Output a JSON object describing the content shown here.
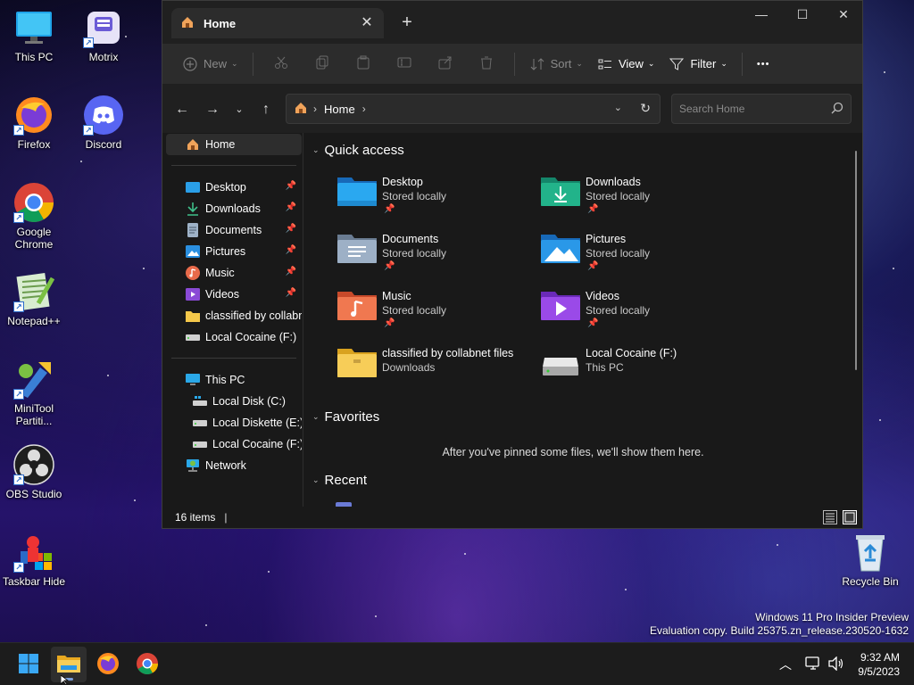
{
  "desktop": {
    "icons": [
      {
        "label": "This PC"
      },
      {
        "label": "Motrix"
      },
      {
        "label": "Firefox"
      },
      {
        "label": "Discord"
      },
      {
        "label": "Google Chrome"
      },
      {
        "label": "Notepad++"
      },
      {
        "label": "MiniTool Partiti..."
      },
      {
        "label": "OBS Studio"
      },
      {
        "label": "Taskbar Hide"
      },
      {
        "label": "Recycle Bin"
      }
    ],
    "watermark": {
      "line1": "Windows 11 Pro Insider Preview",
      "line2": "Evaluation copy. Build 25375.zn_release.230520-1632"
    }
  },
  "explorer": {
    "tab_title": "Home",
    "tab_close": "✕",
    "new_tab": "+",
    "window_controls": {
      "minimize": "—",
      "maximize": "☐",
      "close": "✕"
    },
    "toolbar": {
      "new_label": "New",
      "sort_label": "Sort",
      "view_label": "View",
      "filter_label": "Filter",
      "more_label": "•••"
    },
    "address": {
      "location": "Home",
      "search_placeholder": "Search Home"
    },
    "sidebar": {
      "home": "Home",
      "pinned": [
        {
          "label": "Desktop"
        },
        {
          "label": "Downloads"
        },
        {
          "label": "Documents"
        },
        {
          "label": "Pictures"
        },
        {
          "label": "Music"
        },
        {
          "label": "Videos"
        },
        {
          "label": "classified by collabnet files"
        },
        {
          "label": "Local Cocaine (F:)"
        }
      ],
      "this_pc": "This PC",
      "drives": [
        {
          "label": "Local Disk (C:)"
        },
        {
          "label": "Local Diskette (E:)"
        },
        {
          "label": "Local Cocaine (F:)"
        }
      ],
      "network": "Network"
    },
    "quick_access": {
      "heading": "Quick access",
      "items": [
        {
          "name": "Desktop",
          "sub": "Stored locally",
          "pinned": true,
          "icon": "desktop-folder-icon"
        },
        {
          "name": "Downloads",
          "sub": "Stored locally",
          "pinned": true,
          "icon": "downloads-folder-icon"
        },
        {
          "name": "Documents",
          "sub": "Stored locally",
          "pinned": true,
          "icon": "documents-folder-icon"
        },
        {
          "name": "Pictures",
          "sub": "Stored locally",
          "pinned": true,
          "icon": "pictures-folder-icon"
        },
        {
          "name": "Music",
          "sub": "Stored locally",
          "pinned": true,
          "icon": "music-folder-icon"
        },
        {
          "name": "Videos",
          "sub": "Stored locally",
          "pinned": true,
          "icon": "videos-folder-icon"
        },
        {
          "name": "classified by collabnet files",
          "sub": "Downloads",
          "pinned": false,
          "icon": "folder-icon"
        },
        {
          "name": "Local Cocaine (F:)",
          "sub": "This PC",
          "pinned": false,
          "icon": "drive-icon"
        }
      ]
    },
    "favorites": {
      "heading": "Favorites",
      "empty_message": "After you've pinned some files, we'll show them here."
    },
    "recent": {
      "heading": "Recent"
    },
    "status": {
      "item_count": "16 items"
    }
  },
  "taskbar": {
    "clock_time": "9:32 AM",
    "clock_date": "9/5/2023",
    "apps": [
      "start-icon",
      "file-explorer-icon",
      "firefox-icon",
      "chrome-icon"
    ]
  }
}
